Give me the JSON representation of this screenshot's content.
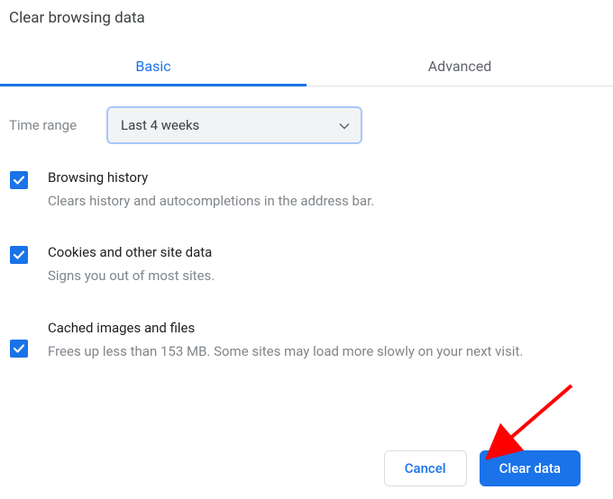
{
  "dialog": {
    "title": "Clear browsing data"
  },
  "tabs": {
    "basic": "Basic",
    "advanced": "Advanced"
  },
  "time_range": {
    "label": "Time range",
    "value": "Last 4 weeks"
  },
  "options": {
    "history": {
      "title": "Browsing history",
      "desc": "Clears history and autocompletions in the address bar."
    },
    "cookies": {
      "title": "Cookies and other site data",
      "desc": "Signs you out of most sites."
    },
    "cache": {
      "title": "Cached images and files",
      "desc": "Frees up less than 153 MB. Some sites may load more slowly on your next visit."
    }
  },
  "buttons": {
    "cancel": "Cancel",
    "clear": "Clear data"
  }
}
